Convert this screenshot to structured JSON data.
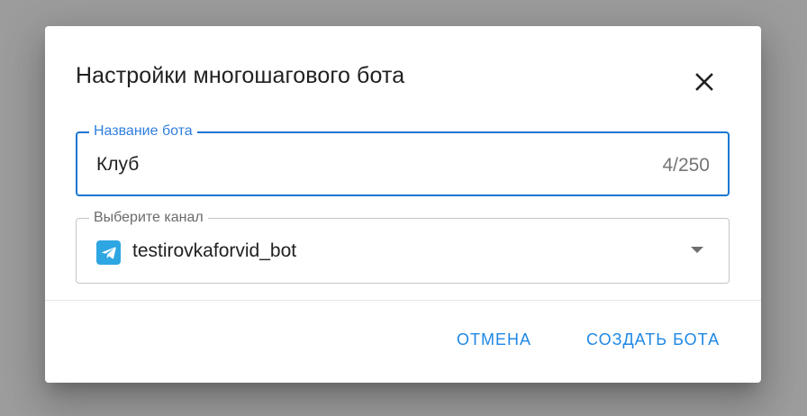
{
  "dialog": {
    "title": "Настройки многошагового бота",
    "close_icon": "close-icon"
  },
  "name_field": {
    "label": "Название бота",
    "value": "Клуб",
    "counter": "4/250"
  },
  "channel_field": {
    "label": "Выберите канал",
    "value": "testirovkaforvid_bot",
    "icon": "telegram-icon",
    "arrow_icon": "dropdown-arrow-icon"
  },
  "actions": {
    "cancel_label": "ОТМЕНА",
    "create_label": "СОЗДАТЬ БОТА"
  },
  "colors": {
    "accent": "#1976d2",
    "telegram": "#2ea6e2",
    "backdrop": "#9c9c9c"
  }
}
